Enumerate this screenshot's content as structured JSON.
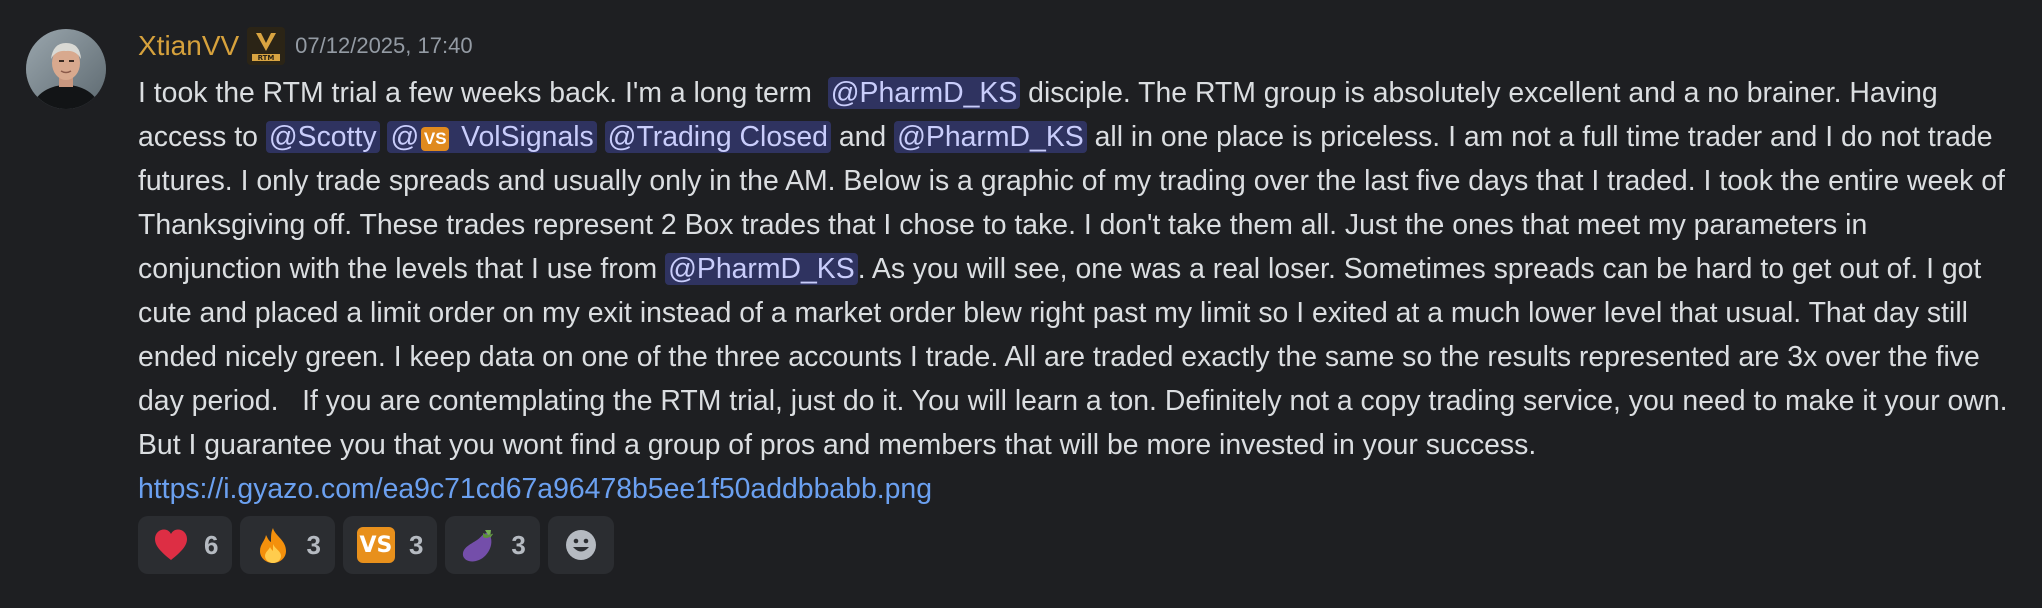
{
  "message": {
    "username": "XtianVV",
    "timestamp": "07/12/2025, 17:40",
    "role_badge_icon": "rtm-role-badge-icon",
    "segments": [
      {
        "type": "text",
        "value": "I took the RTM trial a few weeks back. I'm a long term  "
      },
      {
        "type": "mention",
        "value": "@PharmD_KS"
      },
      {
        "type": "text",
        "value": " disciple. The RTM group is absolutely excellent and a no brainer. Having access to "
      },
      {
        "type": "mention",
        "value": "@Scotty"
      },
      {
        "type": "text",
        "value": " "
      },
      {
        "type": "mention",
        "value": "@",
        "icon": "vs-emoji-icon",
        "after_icon": " VolSignals"
      },
      {
        "type": "text",
        "value": " "
      },
      {
        "type": "mention",
        "value": "@Trading Closed"
      },
      {
        "type": "text",
        "value": " and "
      },
      {
        "type": "mention",
        "value": "@PharmD_KS"
      },
      {
        "type": "text",
        "value": " all in one place is priceless. I am not a full time trader and I do not trade futures. I only trade spreads and usually only in the AM. Below is a graphic of my trading over the last five days that I traded. I took the entire week of Thanksgiving off. These trades represent 2 Box trades that I chose to take. I don't take them all. Just the ones that meet my parameters in conjunction with the levels that I use from "
      },
      {
        "type": "mention",
        "value": "@PharmD_KS"
      },
      {
        "type": "text",
        "value": ". As you will see, one was a real loser. Sometimes spreads can be hard to get out of. I got cute and placed a limit order on my exit instead of a market order blew right past my limit so I exited at a much lower level that usual. That day still ended nicely green. I keep data on one of the three accounts I trade. All are traded exactly the same so the results represented are 3x over the five day period.   If you are contemplating the RTM trial, just do it. You will learn a ton. Definitely not a copy trading service, you need to make it your own. But I guarantee you that you wont find a group of pros and members that will be more invested in your success. "
      },
      {
        "type": "link",
        "value": "https://i.gyazo.com/ea9c71cd67a96478b5ee1f50addbbabb.png"
      }
    ],
    "reactions": [
      {
        "icon": "heart-emoji-icon",
        "count": "6"
      },
      {
        "icon": "fire-emoji-icon",
        "count": "3"
      },
      {
        "icon": "vs-emoji-icon",
        "label": "VS",
        "count": "3"
      },
      {
        "icon": "eggplant-emoji-icon",
        "count": "3"
      }
    ],
    "add_reaction_icon": "add-reaction-smiley-icon",
    "colors": {
      "username": "#d6a13c",
      "mention_bg": "#3c4270",
      "mention_text": "#c9cdfb",
      "link": "#6ba0f0",
      "background": "#1e1f22"
    }
  }
}
